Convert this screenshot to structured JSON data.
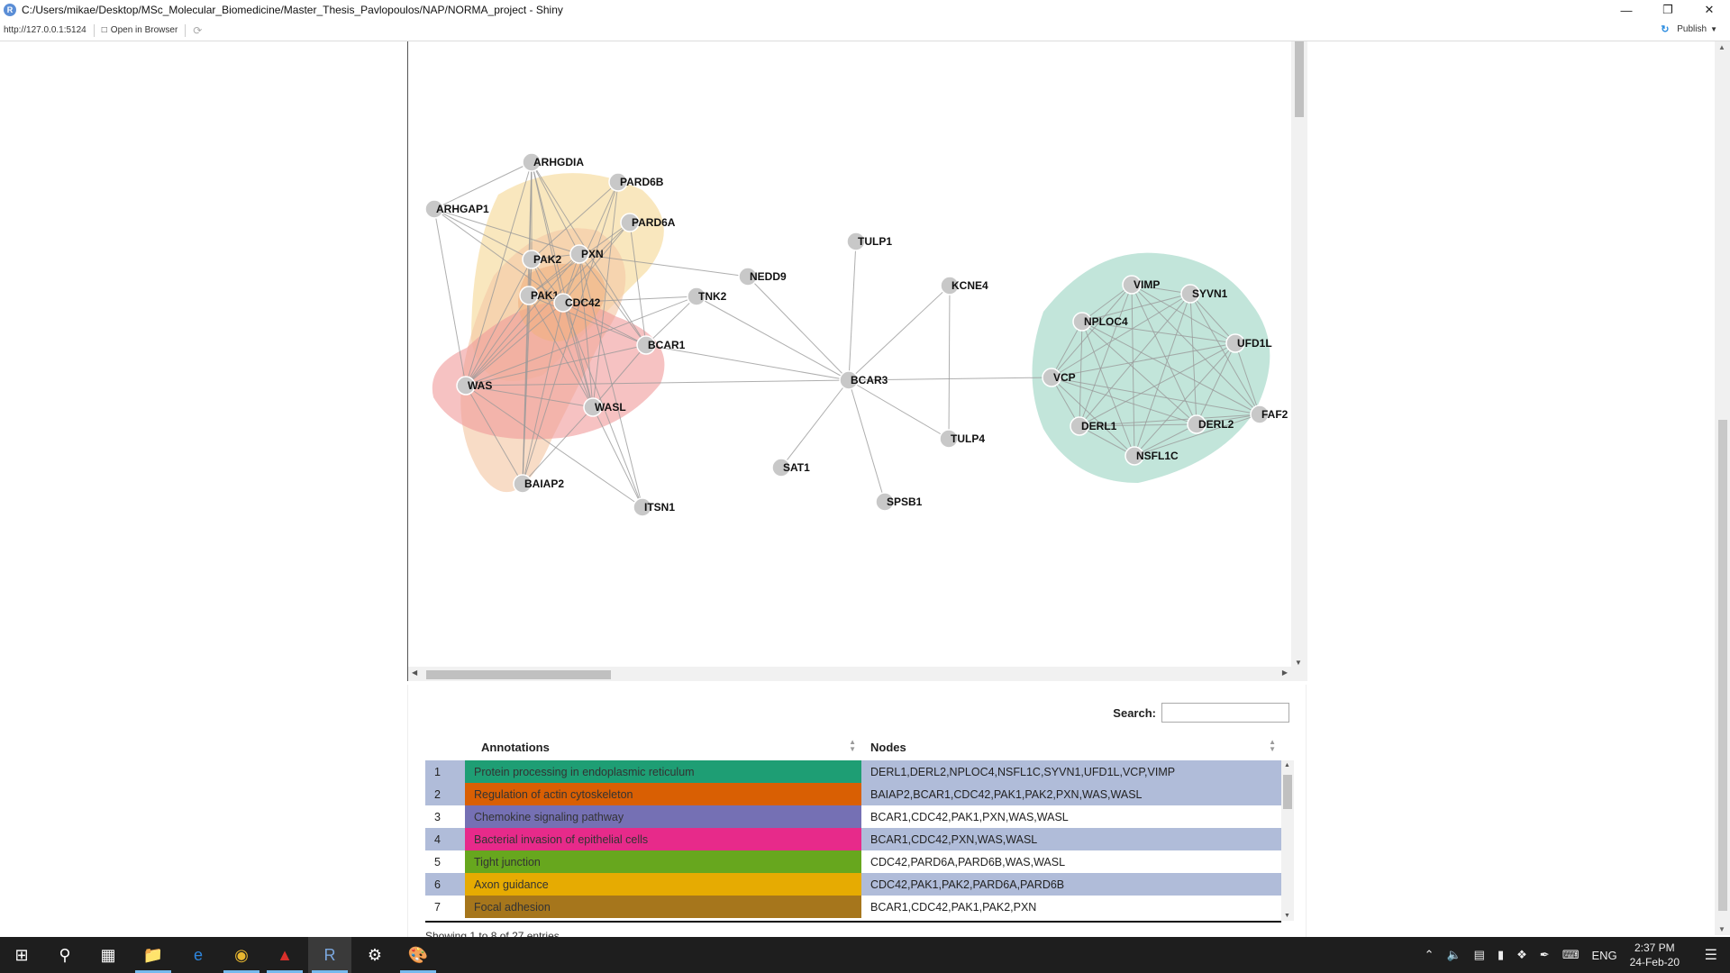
{
  "window": {
    "title": "C:/Users/mikae/Desktop/MSc_Molecular_Biomedicine/Master_Thesis_Pavlopoulos/NAP/NORMA_project - Shiny",
    "url": "http://127.0.0.1:5124",
    "open_in_browser": "Open in Browser",
    "publish": "Publish"
  },
  "network": {
    "nodes": [
      {
        "id": "ARHGDIA"
      },
      {
        "id": "PARD6B"
      },
      {
        "id": "ARHGAP1"
      },
      {
        "id": "PARD6A"
      },
      {
        "id": "PAK2"
      },
      {
        "id": "PXN"
      },
      {
        "id": "PAK1"
      },
      {
        "id": "CDC42"
      },
      {
        "id": "TNK2"
      },
      {
        "id": "BCAR1"
      },
      {
        "id": "WAS"
      },
      {
        "id": "WASL"
      },
      {
        "id": "BAIAP2"
      },
      {
        "id": "ITSN1"
      },
      {
        "id": "NEDD9"
      },
      {
        "id": "TULP1"
      },
      {
        "id": "KCNE4"
      },
      {
        "id": "BCAR3"
      },
      {
        "id": "TULP4"
      },
      {
        "id": "SAT1"
      },
      {
        "id": "SPSB1"
      },
      {
        "id": "VIMP"
      },
      {
        "id": "SYVN1"
      },
      {
        "id": "NPLOC4"
      },
      {
        "id": "UFD1L"
      },
      {
        "id": "VCP"
      },
      {
        "id": "DERL1"
      },
      {
        "id": "DERL2"
      },
      {
        "id": "NSFL1C"
      },
      {
        "id": "FAF2"
      }
    ],
    "edges": [
      [
        "ARHGDIA",
        "ARHGAP1"
      ],
      [
        "ARHGDIA",
        "PAK2"
      ],
      [
        "ARHGDIA",
        "PXN"
      ],
      [
        "ARHGDIA",
        "PAK1"
      ],
      [
        "ARHGDIA",
        "CDC42"
      ],
      [
        "ARHGDIA",
        "WAS"
      ],
      [
        "ARHGDIA",
        "WASL"
      ],
      [
        "ARHGDIA",
        "BCAR1"
      ],
      [
        "ARHGDIA",
        "BAIAP2"
      ],
      [
        "ARHGAP1",
        "PAK2"
      ],
      [
        "ARHGAP1",
        "PXN"
      ],
      [
        "ARHGAP1",
        "CDC42"
      ],
      [
        "ARHGAP1",
        "WAS"
      ],
      [
        "PARD6B",
        "CDC42"
      ],
      [
        "PARD6B",
        "PAK2"
      ],
      [
        "PARD6B",
        "WASL"
      ],
      [
        "PARD6B",
        "BAIAP2"
      ],
      [
        "PARD6A",
        "CDC42"
      ],
      [
        "PARD6A",
        "PAK1"
      ],
      [
        "PARD6A",
        "WAS"
      ],
      [
        "PARD6A",
        "BCAR1"
      ],
      [
        "PAK2",
        "PXN"
      ],
      [
        "PAK2",
        "PAK1"
      ],
      [
        "PAK2",
        "CDC42"
      ],
      [
        "PAK2",
        "WAS"
      ],
      [
        "PAK2",
        "WASL"
      ],
      [
        "PAK2",
        "BAIAP2"
      ],
      [
        "PXN",
        "PAK1"
      ],
      [
        "PXN",
        "CDC42"
      ],
      [
        "PXN",
        "BCAR1"
      ],
      [
        "PXN",
        "NEDD9"
      ],
      [
        "PXN",
        "WAS"
      ],
      [
        "PXN",
        "WASL"
      ],
      [
        "PXN",
        "ITSN1"
      ],
      [
        "PAK1",
        "CDC42"
      ],
      [
        "PAK1",
        "WAS"
      ],
      [
        "PAK1",
        "WASL"
      ],
      [
        "PAK1",
        "BCAR1"
      ],
      [
        "PAK1",
        "BAIAP2"
      ],
      [
        "CDC42",
        "TNK2"
      ],
      [
        "CDC42",
        "BCAR1"
      ],
      [
        "CDC42",
        "WAS"
      ],
      [
        "CDC42",
        "WASL"
      ],
      [
        "CDC42",
        "BAIAP2"
      ],
      [
        "CDC42",
        "ITSN1"
      ],
      [
        "TNK2",
        "WAS"
      ],
      [
        "TNK2",
        "BCAR1"
      ],
      [
        "BCAR1",
        "BCAR3"
      ],
      [
        "BCAR1",
        "WAS"
      ],
      [
        "BCAR1",
        "WASL"
      ],
      [
        "WAS",
        "WASL"
      ],
      [
        "WAS",
        "BAIAP2"
      ],
      [
        "WAS",
        "ITSN1"
      ],
      [
        "WASL",
        "BAIAP2"
      ],
      [
        "WASL",
        "ITSN1"
      ],
      [
        "NEDD9",
        "BCAR3"
      ],
      [
        "TNK2",
        "BCAR3"
      ],
      [
        "WAS",
        "BCAR3"
      ],
      [
        "TULP1",
        "BCAR3"
      ],
      [
        "KCNE4",
        "BCAR3"
      ],
      [
        "KCNE4",
        "TULP4"
      ],
      [
        "BCAR3",
        "TULP4"
      ],
      [
        "BCAR3",
        "SAT1"
      ],
      [
        "BCAR3",
        "SPSB1"
      ],
      [
        "BCAR3",
        "VCP"
      ],
      [
        "VIMP",
        "SYVN1"
      ],
      [
        "VIMP",
        "NPLOC4"
      ],
      [
        "VIMP",
        "UFD1L"
      ],
      [
        "VIMP",
        "VCP"
      ],
      [
        "VIMP",
        "DERL1"
      ],
      [
        "VIMP",
        "DERL2"
      ],
      [
        "VIMP",
        "NSFL1C"
      ],
      [
        "VIMP",
        "FAF2"
      ],
      [
        "SYVN1",
        "NPLOC4"
      ],
      [
        "SYVN1",
        "UFD1L"
      ],
      [
        "SYVN1",
        "VCP"
      ],
      [
        "SYVN1",
        "DERL1"
      ],
      [
        "SYVN1",
        "DERL2"
      ],
      [
        "SYVN1",
        "NSFL1C"
      ],
      [
        "SYVN1",
        "FAF2"
      ],
      [
        "NPLOC4",
        "UFD1L"
      ],
      [
        "NPLOC4",
        "VCP"
      ],
      [
        "NPLOC4",
        "DERL1"
      ],
      [
        "NPLOC4",
        "DERL2"
      ],
      [
        "NPLOC4",
        "NSFL1C"
      ],
      [
        "NPLOC4",
        "FAF2"
      ],
      [
        "UFD1L",
        "VCP"
      ],
      [
        "UFD1L",
        "DERL1"
      ],
      [
        "UFD1L",
        "DERL2"
      ],
      [
        "UFD1L",
        "NSFL1C"
      ],
      [
        "UFD1L",
        "FAF2"
      ],
      [
        "VCP",
        "DERL1"
      ],
      [
        "VCP",
        "DERL2"
      ],
      [
        "VCP",
        "NSFL1C"
      ],
      [
        "VCP",
        "FAF2"
      ],
      [
        "DERL1",
        "DERL2"
      ],
      [
        "DERL1",
        "NSFL1C"
      ],
      [
        "DERL1",
        "FAF2"
      ],
      [
        "DERL2",
        "NSFL1C"
      ],
      [
        "DERL2",
        "FAF2"
      ],
      [
        "NSFL1C",
        "FAF2"
      ]
    ],
    "groups": [
      {
        "color": "#f7dfa8",
        "opacity": 0.75
      },
      {
        "color": "#f5c9a8",
        "opacity": 0.65
      },
      {
        "color": "#f09a9a",
        "opacity": 0.6
      },
      {
        "color": "#f0b080",
        "opacity": 0.6
      },
      {
        "color": "#b7e0d3",
        "opacity": 0.85
      }
    ]
  },
  "table": {
    "search_label": "Search:",
    "search_value": "",
    "headers": {
      "annotations": "Annotations",
      "nodes": "Nodes"
    },
    "rows": [
      {
        "idx": "1",
        "annotation": "Protein processing in endoplasmic reticulum",
        "nodes": "DERL1,DERL2,NPLOC4,NSFL1C,SYVN1,UFD1L,VCP,VIMP",
        "color": "#1e9e74"
      },
      {
        "idx": "2",
        "annotation": "Regulation of actin cytoskeleton",
        "nodes": "BAIAP2,BCAR1,CDC42,PAK1,PAK2,PXN,WAS,WASL",
        "color": "#d95f03"
      },
      {
        "idx": "3",
        "annotation": "Chemokine signaling pathway",
        "nodes": "BCAR1,CDC42,PAK1,PXN,WAS,WASL",
        "color": "#7570b4"
      },
      {
        "idx": "4",
        "annotation": "Bacterial invasion of epithelial cells",
        "nodes": "BCAR1,CDC42,PXN,WAS,WASL",
        "color": "#e72a8a"
      },
      {
        "idx": "5",
        "annotation": "Tight junction",
        "nodes": "CDC42,PARD6A,PARD6B,WAS,WASL",
        "color": "#67a71e"
      },
      {
        "idx": "6",
        "annotation": "Axon guidance",
        "nodes": "CDC42,PAK1,PAK2,PARD6A,PARD6B",
        "color": "#e6ab02"
      },
      {
        "idx": "7",
        "annotation": "Focal adhesion",
        "nodes": "BCAR1,CDC42,PAK1,PAK2,PXN",
        "color": "#a6761c"
      }
    ],
    "footer": "Showing 1 to 8 of 27 entries"
  },
  "taskbar": {
    "language": "ENG",
    "time": "2:37 PM",
    "date": "24-Feb-20"
  }
}
